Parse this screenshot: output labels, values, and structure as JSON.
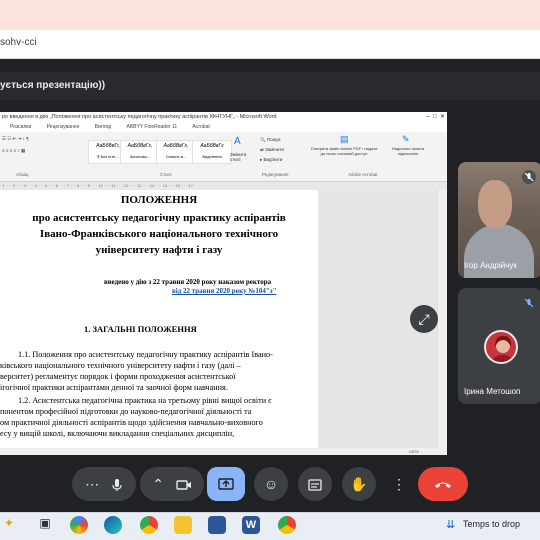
{
  "browser": {
    "url_fragment": "sohv-cci"
  },
  "presenting_banner": "ується презентацію))",
  "word": {
    "title": "ро введення в дію „Положення про асистентську педагогічну практику аспірантів ІФНТУНГ„ - Microsoft Word",
    "tabs": [
      "Розсилки",
      "Рецензування",
      "Вигляд",
      "ABBYY FineReader 11",
      "Acrobat"
    ],
    "styles": [
      {
        "preview": "АаБбВвГг,",
        "name": "¶ Без інте..."
      },
      {
        "preview": "АаБбВвГг,",
        "name": "Заголово..."
      },
      {
        "preview": "АаБбВвГг,",
        "name": "Сильне в..."
      },
      {
        "preview": "АаБбВвГг",
        "name": "Виділення"
      }
    ],
    "change_styles": "Змінити стилі",
    "find_label": "Пошук",
    "replace_label": "Замінити",
    "select_label": "Виділити",
    "acrobat_create": "Створити файл Adobe PDF і надати до нього спільний доступ",
    "acrobat_sign": "Надіслати запити підписання",
    "group_paragraph": "Абзац",
    "group_styles": "Стилі",
    "group_editing": "Редагування",
    "group_acrobat": "Adobe Acrobat",
    "status_zoom": "100%"
  },
  "document": {
    "title": "ПОЛОЖЕННЯ",
    "subtitle_lines": [
      "про асистентську педагогічну практику аспірантів",
      "Івано-Франківського національного технічного",
      "університету нафти і газу"
    ],
    "enacted": "введено у дію з 22 травня 2020 року наказом ректора",
    "order": "від 22 травня 2020 року №104\"з\"",
    "section": "1. ЗАГАЛЬНІ ПОЛОЖЕННЯ",
    "body_lines": [
      "1.1. Положення про асистентську педагогічну практику аспірантів Івано-",
      "ківського національного технічного університету нафти і газу (далі –",
      "верситет) регламентує порядок і форми проходження асистентської",
      "ігогічної практики аспірантами денної та заочної форм навчання.",
      "1.2. Асистентська педагогічна практика на третьому рівні вищої освіти є",
      "понентом професійної підготовки до науково-педагогічної діяльності та",
      "ом практичної діяльності аспірантів щодо здійснення навчально-виховного",
      "есу у вищій школі, включаючи викладання спеціальних дисциплін,"
    ]
  },
  "participants": [
    {
      "name": "Ігор Андрійчук",
      "mic": "muted"
    },
    {
      "name": "Ірина Метошоп",
      "mic": "muted"
    }
  ],
  "taskbar": {
    "weather_text": "Temps to drop"
  },
  "colors": {
    "end_call": "#ea4335",
    "present_active": "#8ab4f8",
    "meet_bg": "#202124"
  }
}
